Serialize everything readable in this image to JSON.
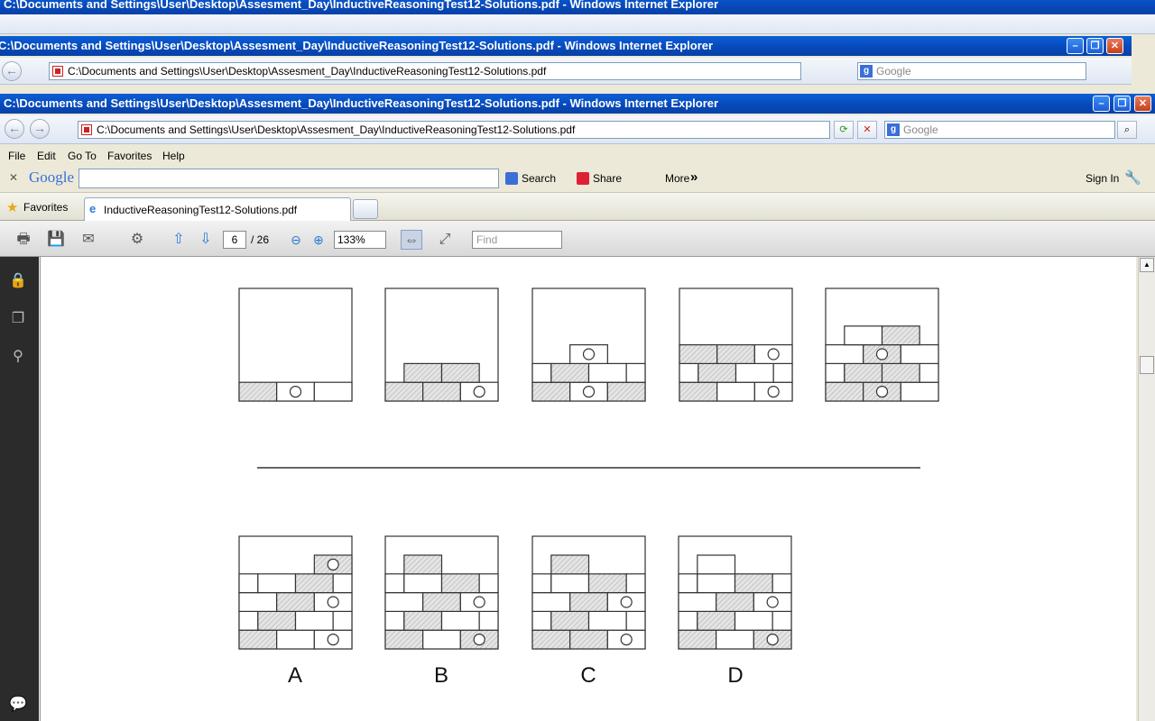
{
  "window": {
    "title": "C:\\Documents and Settings\\User\\Desktop\\Assesment_Day\\InductiveReasoningTest12-Solutions.pdf - Windows Internet Explorer",
    "address": "C:\\Documents and Settings\\User\\Desktop\\Assesment_Day\\InductiveReasoningTest12-Solutions.pdf",
    "search_placeholder": "Google",
    "btn_min": "–",
    "btn_max": "❐",
    "btn_close": "✕"
  },
  "menu": {
    "file": "File",
    "edit": "Edit",
    "goto": "Go To",
    "favorites": "Favorites",
    "help": "Help"
  },
  "google_bar": {
    "close": "✕",
    "logo": "Google",
    "search": "Search",
    "share": "Share",
    "more": "More",
    "more_arrow": "»",
    "signin": "Sign In"
  },
  "favorites_bar": {
    "label": "Favorites",
    "tab_title": "InductiveReasoningTest12-Solutions.pdf"
  },
  "pdf_toolbar": {
    "page_current": "6",
    "page_total": "/ 26",
    "zoom": "133%",
    "find_placeholder": "Find"
  },
  "answer_labels": [
    "A",
    "B",
    "C",
    "D"
  ],
  "colors": {
    "title_blue": "#0848b8",
    "sidebar": "#2b2b2b",
    "brick_hatch": "#d8d8d8"
  }
}
